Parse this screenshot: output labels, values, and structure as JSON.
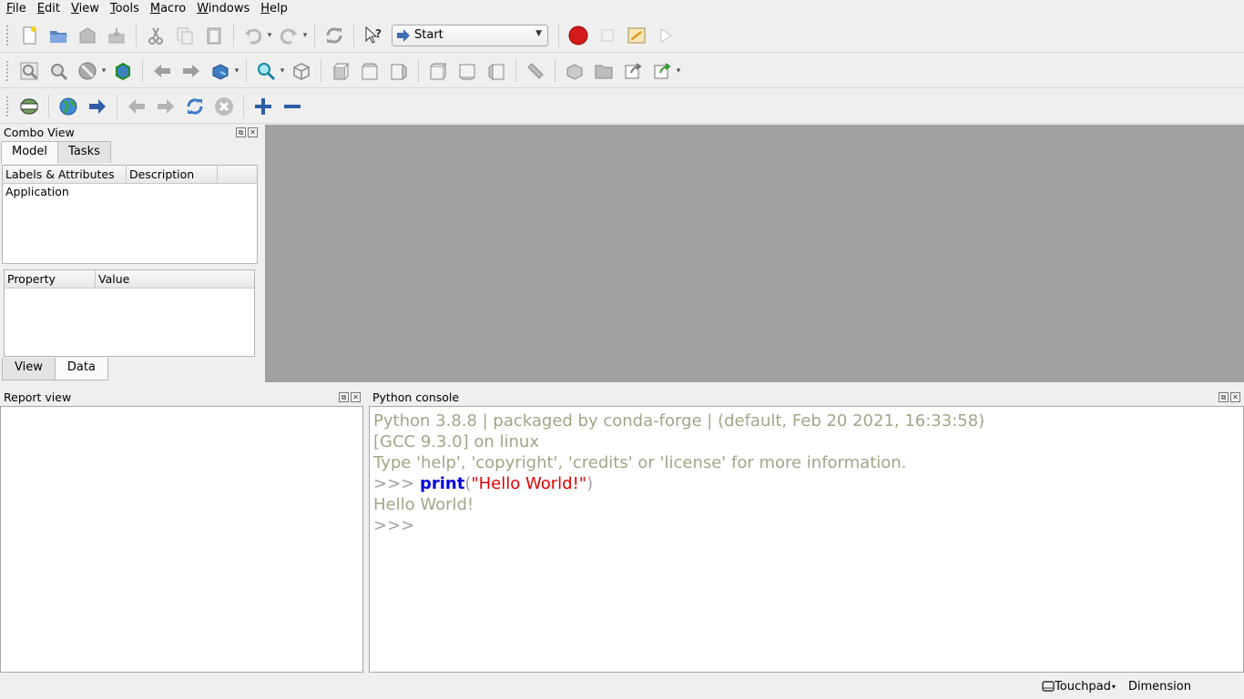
{
  "menu": [
    {
      "label": "File",
      "u": "F",
      "rest": "ile"
    },
    {
      "label": "Edit",
      "u": "E",
      "rest": "dit"
    },
    {
      "label": "View",
      "u": "V",
      "rest": "iew"
    },
    {
      "label": "Tools",
      "u": "T",
      "rest": "ools"
    },
    {
      "label": "Macro",
      "u": "M",
      "rest": "acro"
    },
    {
      "label": "Windows",
      "u": "W",
      "rest": "indows"
    },
    {
      "label": "Help",
      "u": "H",
      "rest": "elp"
    }
  ],
  "toolbar": {
    "workbench_selected": "Start"
  },
  "combo_view": {
    "title": "Combo View",
    "tabs": [
      "Model",
      "Tasks"
    ],
    "tree_headers": [
      "Labels & Attributes",
      "Description"
    ],
    "tree_items": [
      "Application"
    ],
    "prop_headers": [
      "Property",
      "Value"
    ],
    "bottom_tabs": [
      "View",
      "Data"
    ]
  },
  "report_view": {
    "title": "Report view"
  },
  "python_console": {
    "title": "Python console",
    "banner1": "Python 3.8.8 | packaged by conda-forge | (default, Feb 20 2021, 16:33:58)",
    "banner2": "[GCC 9.3.0] on linux",
    "banner3": "Type 'help', 'copyright', 'credits' or 'license' for more information.",
    "prompt": ">>> ",
    "cmd_kw": "print",
    "cmd_open": "(",
    "cmd_str": "\"Hello World!\"",
    "cmd_close": ")",
    "output": "Hello World!",
    "prompt2": ">>>"
  },
  "statusbar": {
    "navigation": "Touchpad",
    "units": "Dimension"
  },
  "colors": {
    "view_bg": "#a0a0a0",
    "console_text": "#a4a487",
    "keyword": "#0000e0",
    "string": "#e00000"
  }
}
